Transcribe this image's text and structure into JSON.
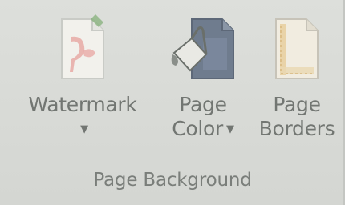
{
  "group": {
    "label": "Page Background"
  },
  "commands": {
    "watermark": {
      "label_line1": "Watermark",
      "dropdown": "▼",
      "icon": "watermark-icon"
    },
    "page_color": {
      "label_line1": "Page",
      "label_line2": "Color",
      "dropdown": "▼",
      "icon": "paint-bucket-icon"
    },
    "page_borders": {
      "label_line1": "Page",
      "label_line2": "Borders",
      "icon": "page-borders-icon"
    }
  }
}
